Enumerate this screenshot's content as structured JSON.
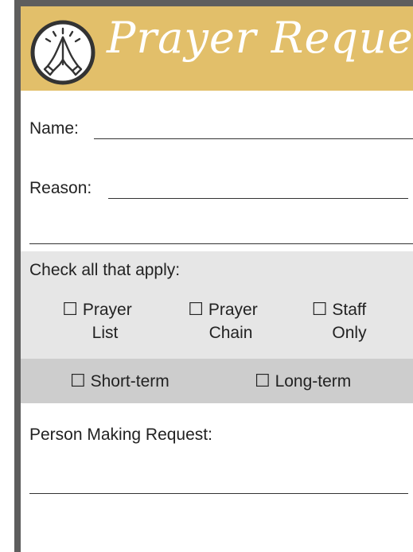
{
  "header": {
    "title": "Prayer Requests",
    "logo_icon": "praying-hands-icon",
    "accent_color": "#e2bf6a"
  },
  "form": {
    "name_label": "Name:",
    "reason_label": "Reason:",
    "check_label": "Check all that apply:",
    "options_row1": [
      {
        "box": "☐",
        "line1": "Prayer",
        "line2": "List"
      },
      {
        "box": "☐",
        "line1": "Prayer",
        "line2": "Chain"
      },
      {
        "box": "☐",
        "line1": "Staff",
        "line2": "Only"
      }
    ],
    "options_row2": [
      {
        "box": "☐",
        "label": "Short-term"
      },
      {
        "box": "☐",
        "label": "Long-term"
      }
    ],
    "person_label": "Person Making Request:"
  }
}
